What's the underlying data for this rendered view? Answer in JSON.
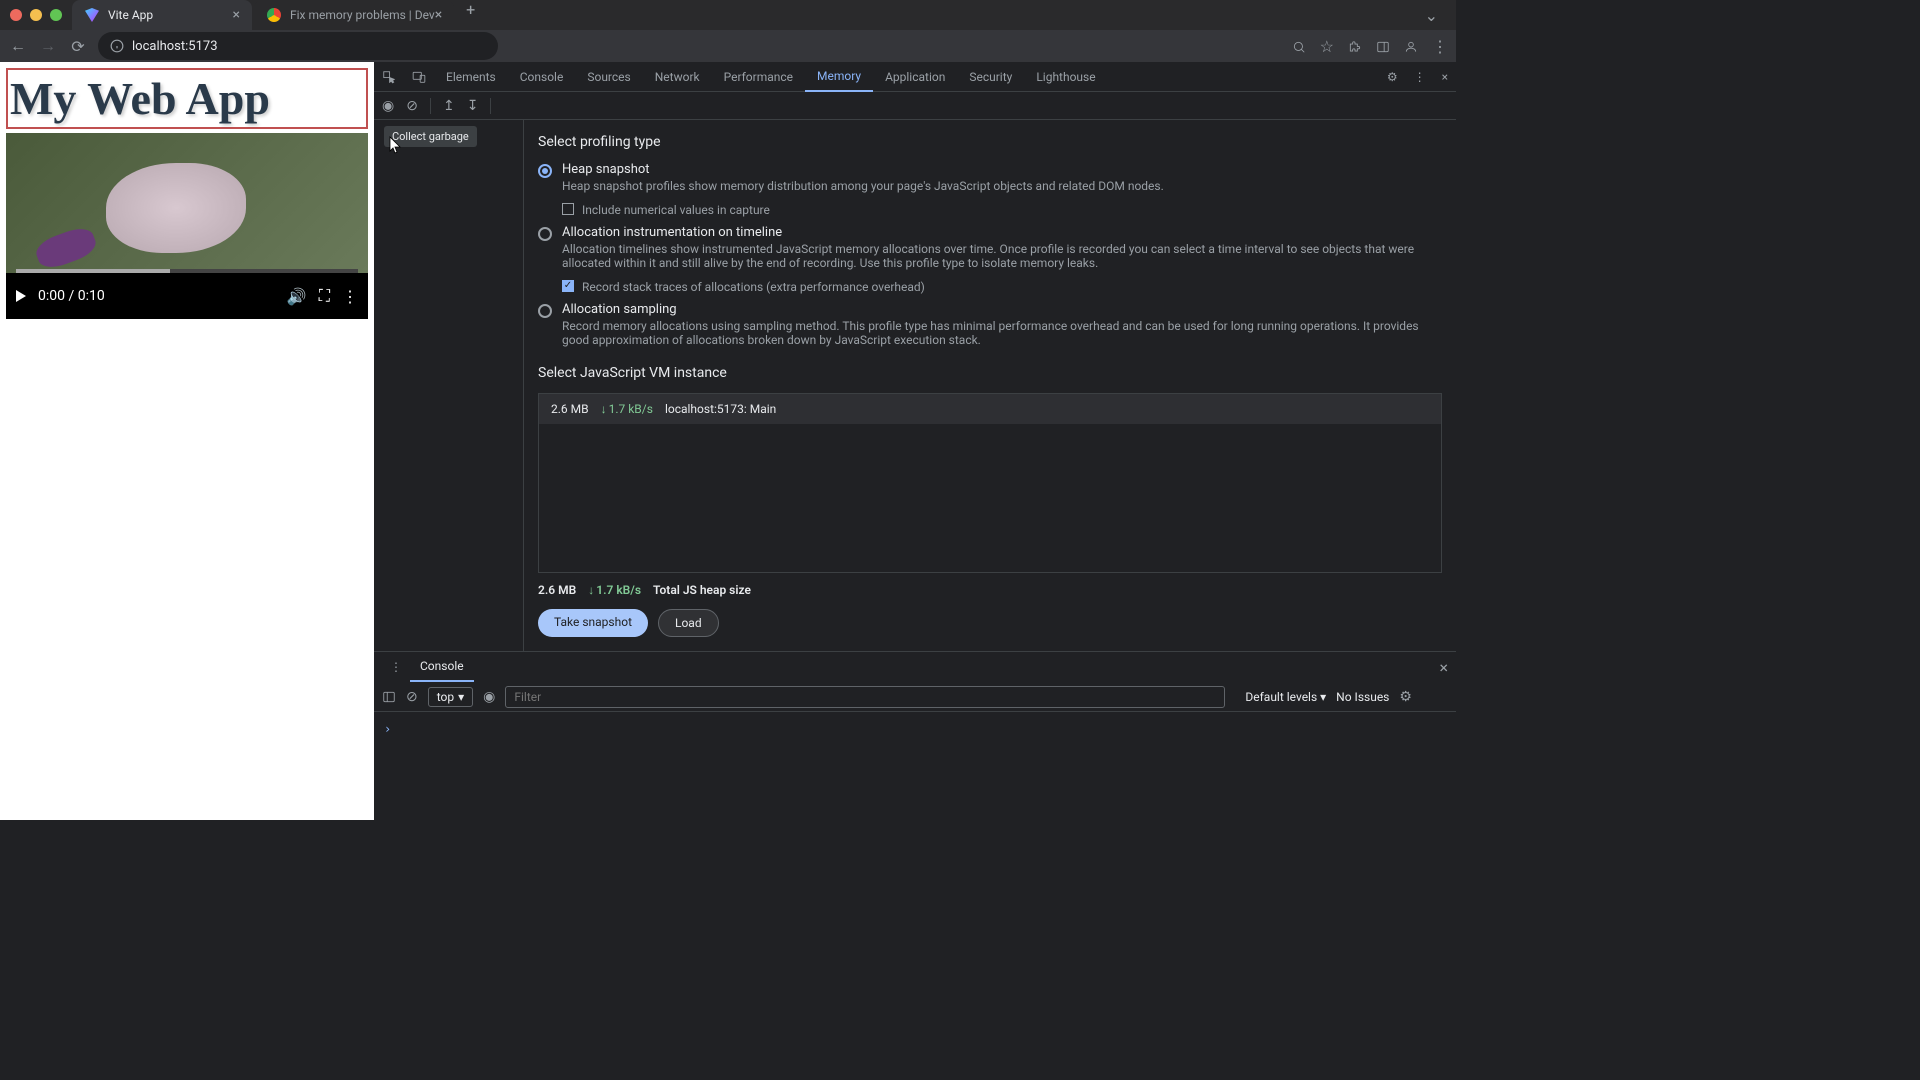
{
  "browser_tabs": [
    {
      "title": "Vite App",
      "active": true
    },
    {
      "title": "Fix memory problems  |  Dev",
      "active": false
    }
  ],
  "url": "localhost:5173",
  "page": {
    "heading": "My Web App",
    "video_time": "0:00 / 0:10"
  },
  "devtools": {
    "tabs": [
      "Elements",
      "Console",
      "Sources",
      "Network",
      "Performance",
      "Memory",
      "Application",
      "Security",
      "Lighthouse"
    ],
    "active_tab": "Memory",
    "tooltip": "Collect garbage",
    "memory": {
      "section1": "Select profiling type",
      "options": [
        {
          "label": "Heap snapshot",
          "desc": "Heap snapshot profiles show memory distribution among your page's JavaScript objects and related DOM nodes.",
          "checked": true,
          "sub": {
            "label": "Include numerical values in capture",
            "checked": false
          }
        },
        {
          "label": "Allocation instrumentation on timeline",
          "desc": "Allocation timelines show instrumented JavaScript memory allocations over time. Once profile is recorded you can select a time interval to see objects that were allocated within it and still alive by the end of recording. Use this profile type to isolate memory leaks.",
          "checked": false,
          "sub": {
            "label": "Record stack traces of allocations (extra performance overhead)",
            "checked": true
          }
        },
        {
          "label": "Allocation sampling",
          "desc": "Record memory allocations using sampling method. This profile type has minimal performance overhead and can be used for long running operations. It provides good approximation of allocations broken down by JavaScript execution stack.",
          "checked": false
        }
      ],
      "section2": "Select JavaScript VM instance",
      "vm": {
        "size": "2.6 MB",
        "rate": "1.7 kB/s",
        "name": "localhost:5173: Main"
      },
      "summary": {
        "size": "2.6 MB",
        "rate": "1.7 kB/s",
        "label": "Total JS heap size"
      },
      "buttons": {
        "primary": "Take snapshot",
        "secondary": "Load"
      }
    }
  },
  "console": {
    "tab": "Console",
    "context": "top",
    "filter_placeholder": "Filter",
    "levels": "Default levels",
    "issues": "No Issues"
  }
}
